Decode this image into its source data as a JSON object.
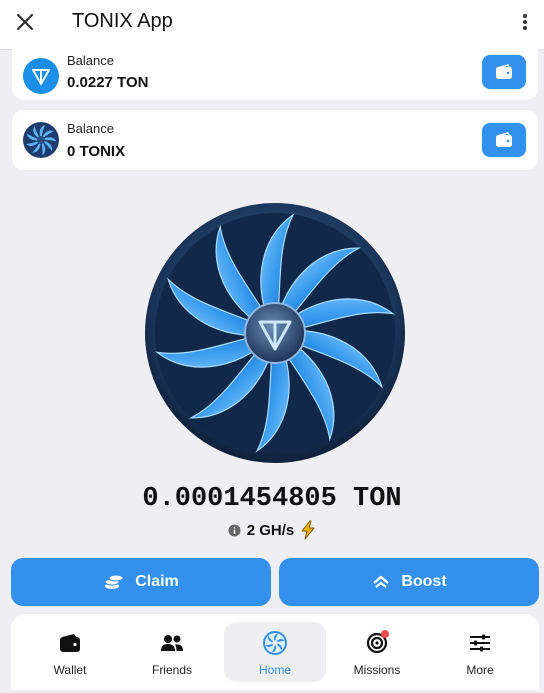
{
  "header": {
    "title": "TONIX App"
  },
  "balances": [
    {
      "label": "Balance",
      "value": "0.0227 TON",
      "coin_icon": "ton-logo-icon"
    },
    {
      "label": "Balance",
      "value": "0 TONIX",
      "coin_icon": "tonix-fan-icon"
    }
  ],
  "miner": {
    "amount": "0.0001454805 TON",
    "rate": "2 GH/s",
    "image_icon": "fan-miner-icon"
  },
  "actions": {
    "claim_label": "Claim",
    "boost_label": "Boost"
  },
  "nav": {
    "items": [
      {
        "label": "Wallet",
        "icon": "wallet-icon",
        "active": false
      },
      {
        "label": "Friends",
        "icon": "friends-icon",
        "active": false
      },
      {
        "label": "Home",
        "icon": "home-fan-icon",
        "active": true
      },
      {
        "label": "Missions",
        "icon": "target-icon",
        "active": false,
        "badge": true
      },
      {
        "label": "More",
        "icon": "sliders-icon",
        "active": false
      }
    ]
  },
  "colors": {
    "accent": "#3390ec",
    "background": "#efeff3",
    "card": "#ffffff",
    "badge": "#ef4b4b",
    "bolt": "#f5b800"
  }
}
